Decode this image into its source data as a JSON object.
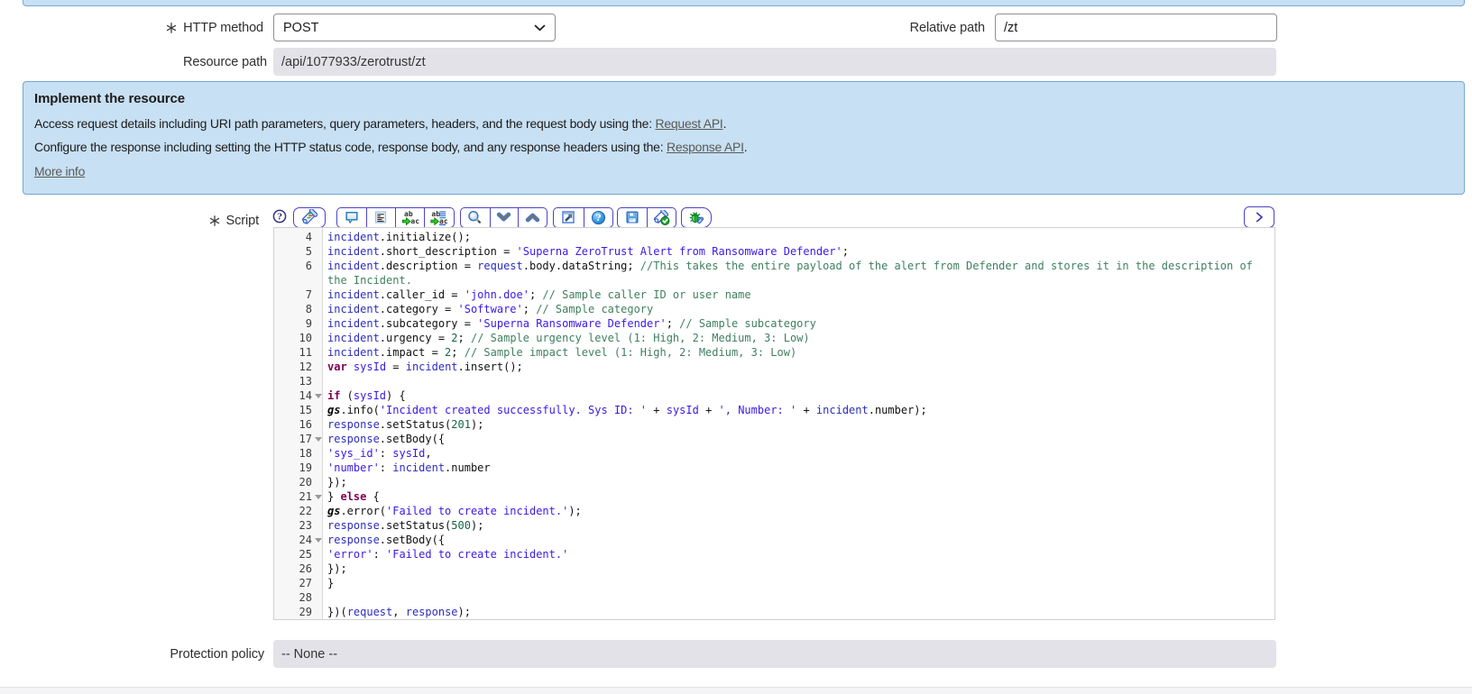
{
  "form": {
    "http_method": {
      "label": "HTTP method",
      "value": "POST"
    },
    "relative_path": {
      "label": "Relative path",
      "value": "/zt"
    },
    "resource_path": {
      "label": "Resource path",
      "value": "/api/1077933/zerotrust/zt"
    },
    "script": {
      "label": "Script"
    },
    "protection_policy": {
      "label": "Protection policy",
      "value": "-- None --"
    }
  },
  "info_box": {
    "title": "Implement the resource",
    "line1_prefix": "Access request details including URI path parameters, query parameters, headers, and the request body using the: ",
    "line1_link": "Request API",
    "line1_suffix": ".",
    "line2_prefix": "Configure the response including setting the HTTP status code, response body, and any response headers using the: ",
    "line2_link": "Response API",
    "line2_suffix": ".",
    "more_info": "More info"
  },
  "toolbar": {
    "buttons": [
      "script-help",
      "scripting-assistance",
      "toggle-comment",
      "format-code",
      "replace",
      "replace-all",
      "search",
      "find-next",
      "find-previous",
      "open-fullscreen",
      "editor-help",
      "save",
      "syntax-check",
      "debug",
      "expand-toolbar"
    ]
  },
  "colors": {
    "info_box_bg": "#c8e0f3",
    "info_box_border": "#74a7d7",
    "toolbar_border": "#4b44c4",
    "readonly_bg": "#e2e2e8"
  },
  "editor": {
    "lines": [
      {
        "n": "4",
        "fold": false,
        "tokens": [
          [
            "v",
            "incident"
          ],
          [
            "p",
            ".initialize();"
          ]
        ]
      },
      {
        "n": "5",
        "fold": false,
        "tokens": [
          [
            "v",
            "incident"
          ],
          [
            "p",
            ".short_description = "
          ],
          [
            "s",
            "'Superna ZeroTrust Alert from Ransomware Defender'"
          ],
          [
            "p",
            ";"
          ]
        ]
      },
      {
        "n": "6",
        "fold": false,
        "tokens": [
          [
            "v",
            "incident"
          ],
          [
            "p",
            ".description = "
          ],
          [
            "v",
            "request"
          ],
          [
            "p",
            ".body.dataString; "
          ],
          [
            "c",
            "//This takes the entire payload of the alert from Defender and stores it in the description of the Incident."
          ]
        ]
      },
      {
        "n": "7",
        "fold": false,
        "tokens": [
          [
            "v",
            "incident"
          ],
          [
            "p",
            ".caller_id = "
          ],
          [
            "s",
            "'john.doe'"
          ],
          [
            "p",
            "; "
          ],
          [
            "c",
            "// Sample caller ID or user name"
          ]
        ]
      },
      {
        "n": "8",
        "fold": false,
        "tokens": [
          [
            "v",
            "incident"
          ],
          [
            "p",
            ".category = "
          ],
          [
            "s",
            "'Software'"
          ],
          [
            "p",
            "; "
          ],
          [
            "c",
            "// Sample category"
          ]
        ]
      },
      {
        "n": "9",
        "fold": false,
        "tokens": [
          [
            "v",
            "incident"
          ],
          [
            "p",
            ".subcategory = "
          ],
          [
            "s",
            "'Superna Ransomware Defender'"
          ],
          [
            "p",
            "; "
          ],
          [
            "c",
            "// Sample subcategory"
          ]
        ]
      },
      {
        "n": "10",
        "fold": false,
        "tokens": [
          [
            "v",
            "incident"
          ],
          [
            "p",
            ".urgency = "
          ],
          [
            "n",
            "2"
          ],
          [
            "p",
            "; "
          ],
          [
            "c",
            "// Sample urgency level (1: High, 2: Medium, 3: Low)"
          ]
        ]
      },
      {
        "n": "11",
        "fold": false,
        "tokens": [
          [
            "v",
            "incident"
          ],
          [
            "p",
            ".impact = "
          ],
          [
            "n",
            "2"
          ],
          [
            "p",
            "; "
          ],
          [
            "c",
            "// Sample impact level (1: High, 2: Medium, 3: Low)"
          ]
        ]
      },
      {
        "n": "12",
        "fold": false,
        "tokens": [
          [
            "k",
            "var"
          ],
          [
            "p",
            " "
          ],
          [
            "d",
            "sysId"
          ],
          [
            "p",
            " = "
          ],
          [
            "v",
            "incident"
          ],
          [
            "p",
            ".insert();"
          ]
        ]
      },
      {
        "n": "13",
        "fold": false,
        "tokens": []
      },
      {
        "n": "14",
        "fold": true,
        "tokens": [
          [
            "k",
            "if"
          ],
          [
            "p",
            " ("
          ],
          [
            "d",
            "sysId"
          ],
          [
            "p",
            ") {"
          ]
        ]
      },
      {
        "n": "15",
        "fold": false,
        "tokens": [
          [
            "g",
            "gs"
          ],
          [
            "p",
            ".info("
          ],
          [
            "s",
            "'Incident created successfully. Sys ID: '"
          ],
          [
            "p",
            " + "
          ],
          [
            "d",
            "sysId"
          ],
          [
            "p",
            " + "
          ],
          [
            "s",
            "', Number: '"
          ],
          [
            "p",
            " + "
          ],
          [
            "v",
            "incident"
          ],
          [
            "p",
            ".number);"
          ]
        ]
      },
      {
        "n": "16",
        "fold": false,
        "tokens": [
          [
            "v",
            "response"
          ],
          [
            "p",
            ".setStatus("
          ],
          [
            "n",
            "201"
          ],
          [
            "p",
            ");"
          ]
        ]
      },
      {
        "n": "17",
        "fold": true,
        "tokens": [
          [
            "v",
            "response"
          ],
          [
            "p",
            ".setBody({"
          ]
        ]
      },
      {
        "n": "18",
        "fold": false,
        "tokens": [
          [
            "s",
            "'sys_id'"
          ],
          [
            "p",
            ": "
          ],
          [
            "d",
            "sysId"
          ],
          [
            "p",
            ","
          ]
        ]
      },
      {
        "n": "19",
        "fold": false,
        "tokens": [
          [
            "s",
            "'number'"
          ],
          [
            "p",
            ": "
          ],
          [
            "v",
            "incident"
          ],
          [
            "p",
            ".number"
          ]
        ]
      },
      {
        "n": "20",
        "fold": false,
        "tokens": [
          [
            "p",
            "});"
          ]
        ]
      },
      {
        "n": "21",
        "fold": true,
        "tokens": [
          [
            "p",
            "} "
          ],
          [
            "k",
            "else"
          ],
          [
            "p",
            " {"
          ]
        ]
      },
      {
        "n": "22",
        "fold": false,
        "tokens": [
          [
            "g",
            "gs"
          ],
          [
            "p",
            ".error("
          ],
          [
            "s",
            "'Failed to create incident.'"
          ],
          [
            "p",
            ");"
          ]
        ]
      },
      {
        "n": "23",
        "fold": false,
        "tokens": [
          [
            "v",
            "response"
          ],
          [
            "p",
            ".setStatus("
          ],
          [
            "n",
            "500"
          ],
          [
            "p",
            ");"
          ]
        ]
      },
      {
        "n": "24",
        "fold": true,
        "tokens": [
          [
            "v",
            "response"
          ],
          [
            "p",
            ".setBody({"
          ]
        ]
      },
      {
        "n": "25",
        "fold": false,
        "tokens": [
          [
            "s",
            "'error'"
          ],
          [
            "p",
            ": "
          ],
          [
            "s",
            "'Failed to create incident.'"
          ]
        ]
      },
      {
        "n": "26",
        "fold": false,
        "tokens": [
          [
            "p",
            "});"
          ]
        ]
      },
      {
        "n": "27",
        "fold": false,
        "tokens": [
          [
            "p",
            "}"
          ]
        ]
      },
      {
        "n": "28",
        "fold": false,
        "tokens": []
      },
      {
        "n": "29",
        "fold": false,
        "tokens": [
          [
            "p",
            "})("
          ],
          [
            "v",
            "request"
          ],
          [
            "p",
            ", "
          ],
          [
            "v",
            "response"
          ],
          [
            "p",
            ");"
          ]
        ]
      }
    ]
  }
}
